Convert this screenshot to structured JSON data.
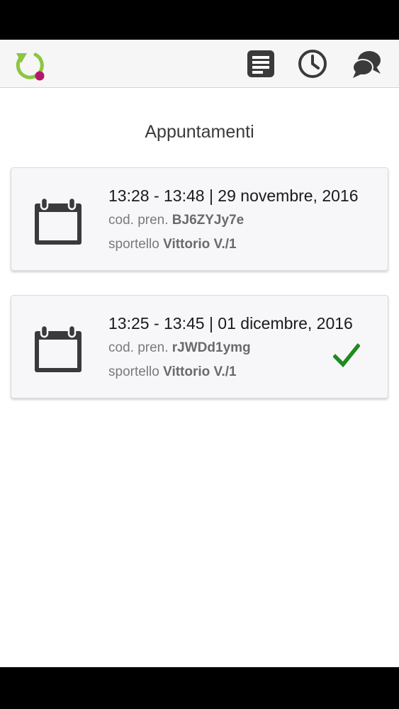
{
  "colors": {
    "brand_green": "#8dc63f",
    "brand_magenta": "#b5166b",
    "icon_dark": "#3a3a3a",
    "check_green": "#1e8b1e"
  },
  "header": {
    "logo": "app-logo-refresh",
    "icons": [
      "list-icon",
      "clock-icon",
      "chat-icon"
    ]
  },
  "page": {
    "title": "Appuntamenti"
  },
  "appointments": [
    {
      "time": "13:28 - 13:48 | 29 novembre, 2016",
      "code_label": "cod. pren.",
      "code": "BJ6ZYJy7e",
      "counter_label": "sportello",
      "counter": "Vittorio V./1",
      "confirmed": false
    },
    {
      "time": "13:25 - 13:45 | 01 dicembre, 2016",
      "code_label": "cod. pren.",
      "code": "rJWDd1ymg",
      "counter_label": "sportello",
      "counter": "Vittorio V./1",
      "confirmed": true
    }
  ]
}
